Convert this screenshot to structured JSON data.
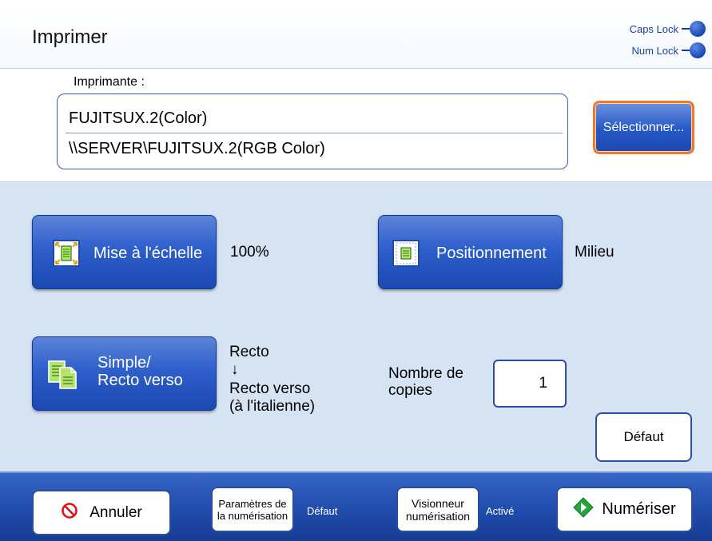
{
  "header": {
    "title": "Imprimer",
    "caps_lock": "Caps Lock",
    "num_lock": "Num Lock"
  },
  "printer": {
    "label": "Imprimante :",
    "name": "FUJITSUX.2(Color)",
    "path": "\\\\SERVER\\FUJITSUX.2(RGB Color)",
    "select_label": "Sélectionner..."
  },
  "settings": {
    "scaling_label": "Mise à l'échelle",
    "scaling_value": "100%",
    "positioning_label": "Positionnement",
    "positioning_value": "Milieu",
    "duplex_label_line1": "Simple/",
    "duplex_label_line2": "Recto verso",
    "duplex_value_line1": "Recto",
    "duplex_value_arrow": "↓",
    "duplex_value_line2": "Recto verso",
    "duplex_value_line3": "(à l'italienne)",
    "copies_label_line1": "Nombre de",
    "copies_label_line2": "copies",
    "copies_value": "1",
    "default_label": "Défaut"
  },
  "footer": {
    "cancel_label": "Annuler",
    "scan_params_line1": "Paramètres de",
    "scan_params_line2": "la numérisation",
    "scan_params_status": "Défaut",
    "viewer_line1": "Visionneur",
    "viewer_line2": "numérisation",
    "viewer_status": "Activé",
    "scan_label": "Numériser"
  },
  "colors": {
    "accent_blue": "#2558c6",
    "focus_orange": "#f07a2a",
    "cancel_red": "#e0141b",
    "scan_green": "#23a83c"
  }
}
